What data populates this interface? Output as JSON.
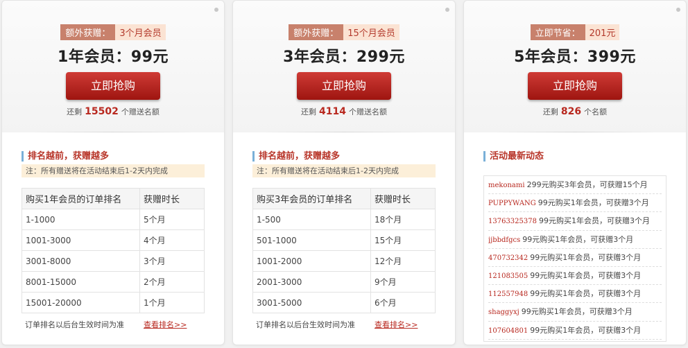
{
  "cards": [
    {
      "badge_label": "额外获赠：",
      "badge_value": "3个月会员",
      "price": "1年会员：99元",
      "buy_label": "立即抢购",
      "remain_prefix": "还剩",
      "remain_count": "15502",
      "remain_suffix": "个赠送名额",
      "section_title": "排名越前，获赠越多",
      "note": "注：所有赠送将在活动结束后1-2天内完成",
      "table": {
        "headers": [
          "购买1年会员的订单排名",
          "获赠时长"
        ],
        "rows": [
          [
            "1-1000",
            "5个月"
          ],
          [
            "1001-3000",
            "4个月"
          ],
          [
            "3001-8000",
            "3个月"
          ],
          [
            "8001-15000",
            "2个月"
          ],
          [
            "15001-20000",
            "1个月"
          ]
        ]
      },
      "footer_text": "订单排名以后台生效时间为准",
      "footer_link": "查看排名>>"
    },
    {
      "badge_label": "额外获赠：",
      "badge_value": "15个月会员",
      "price": "3年会员：299元",
      "buy_label": "立即抢购",
      "remain_prefix": "还剩",
      "remain_count": "4114",
      "remain_suffix": "个赠送名额",
      "section_title": "排名越前，获赠越多",
      "note": "注：所有赠送将在活动结束后1-2天内完成",
      "table": {
        "headers": [
          "购买3年会员的订单排名",
          "获赠时长"
        ],
        "rows": [
          [
            "1-500",
            "18个月"
          ],
          [
            "501-1000",
            "15个月"
          ],
          [
            "1001-2000",
            "12个月"
          ],
          [
            "2001-3000",
            "9个月"
          ],
          [
            "3001-5000",
            "6个月"
          ]
        ]
      },
      "footer_text": "订单排名以后台生效时间为准",
      "footer_link": "查看排名>>"
    },
    {
      "badge_label": "立即节省：",
      "badge_value": "201元",
      "price": "5年会员：399元",
      "buy_label": "立即抢购",
      "remain_prefix": "还剩",
      "remain_count": "826",
      "remain_suffix": "个名额",
      "section_title": "活动最新动态",
      "feed": [
        {
          "user": "mekonami",
          "text": "299元购买3年会员，可获赠15个月"
        },
        {
          "user": "PUPPYWANG",
          "text": "99元购买1年会员，可获赠3个月"
        },
        {
          "user": "13763325378",
          "text": "99元购买1年会员，可获赠3个月"
        },
        {
          "user": "jjbbdfgcs",
          "text": "99元购买1年会员，可获赠3个月"
        },
        {
          "user": "470732342",
          "text": "99元购买1年会员，可获赠3个月"
        },
        {
          "user": "121083505",
          "text": "99元购买1年会员，可获赠3个月"
        },
        {
          "user": "112557948",
          "text": "99元购买1年会员，可获赠3个月"
        },
        {
          "user": "shaggyxj",
          "text": "99元购买1年会员，可获赠3个月"
        },
        {
          "user": "107604801",
          "text": "99元购买1年会员，可获赠3个月"
        }
      ]
    }
  ]
}
